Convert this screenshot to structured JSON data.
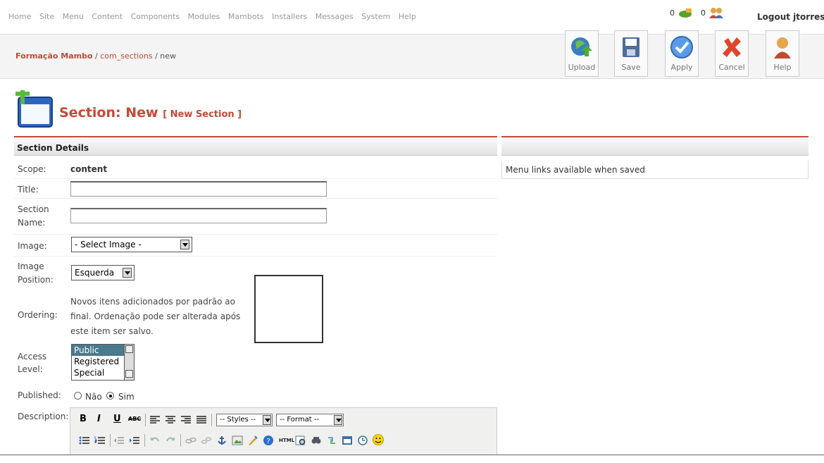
{
  "top_menu": [
    "Home",
    "Site",
    "Menu",
    "Content",
    "Components",
    "Modules",
    "Mambots",
    "Installers",
    "Messages",
    "System",
    "Help"
  ],
  "status": {
    "messages_count": "0",
    "users_count": "0",
    "logout": "Logout jtorres"
  },
  "pathway": {
    "site": "Formação Mambo",
    "component": "com_sections",
    "current": "new",
    "sep1": " / ",
    "sep2": " / "
  },
  "toolbar": {
    "upload": "Upload",
    "save": "Save",
    "apply": "Apply",
    "cancel": "Cancel",
    "help": "Help"
  },
  "page": {
    "title": "Section: New",
    "subtitle": "[ New Section ]"
  },
  "form": {
    "header": "Section Details",
    "scope_label": "Scope:",
    "scope_value": "content",
    "title_label": "Title:",
    "title_value": "",
    "section_name_label_1": "Section",
    "section_name_label_2": "Name:",
    "section_name_value": "",
    "image_label": "Image:",
    "image_selected": "- Select Image -",
    "image_position_label_1": "Image",
    "image_position_label_2": "Position:",
    "image_position_selected": "Esquerda",
    "ordering_label": "Ordering:",
    "ordering_text": "Novos itens adicionados por padrão ao final. Ordenação pode ser alterada após este item ser salvo.",
    "access_label_1": "Access",
    "access_label_2": "Level:",
    "access_options": [
      "Public",
      "Registered",
      "Special"
    ],
    "access_selected": "Public",
    "published_label": "Published:",
    "published_no": "Não",
    "published_yes": "Sim",
    "published_value": "Sim",
    "description_label": "Description:"
  },
  "editor": {
    "bold": "B",
    "italic": "I",
    "underline": "U",
    "strike": "ABC",
    "styles": "-- Styles --",
    "format": "-- Format --",
    "html": "HTML"
  },
  "right_panel": {
    "header": "",
    "menu_links_text": "Menu links available when saved"
  },
  "colors": {
    "accent": "#c64934",
    "panel_border": "#c64934",
    "selected_option": "#4a7a8c"
  }
}
